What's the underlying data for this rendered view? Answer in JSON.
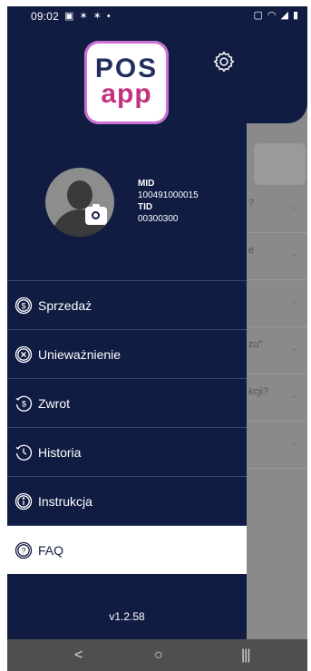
{
  "status_bar": {
    "time": "09:02",
    "left_icons": [
      "image-icon",
      "person-walk-icon",
      "person-walk-icon",
      "dot-icon"
    ],
    "right_icons": [
      "vibrate-icon",
      "wifi-icon",
      "signal-icon",
      "battery-icon"
    ]
  },
  "logo": {
    "line1": "POS",
    "line2": "app",
    "border_color": "#c96fd6",
    "line2_color": "#c0327d"
  },
  "profile": {
    "mid_label": "MID",
    "mid_value": "100491000015",
    "tid_label": "TID",
    "tid_value": "00300300"
  },
  "menu": [
    {
      "label": "Sprzedaż",
      "icon": "dollar-circle-icon",
      "active": false
    },
    {
      "label": "Unieważnienie",
      "icon": "x-circle-icon",
      "active": false
    },
    {
      "label": "Zwrot",
      "icon": "refund-icon",
      "active": false
    },
    {
      "label": "Historia",
      "icon": "history-icon",
      "active": false
    },
    {
      "label": "Instrukcja",
      "icon": "info-circle-icon",
      "active": false
    },
    {
      "label": "FAQ",
      "icon": "question-circle-icon",
      "active": true
    }
  ],
  "version": "v1.2.58",
  "background_fragments": [
    "?",
    "e",
    "zu\"",
    "kcji?"
  ],
  "colors": {
    "drawer": "#111c43",
    "active_item": "#ffffff",
    "navbar": "#4f4f4f"
  },
  "navbar": {
    "back": "<",
    "home": "○",
    "recents": "|||"
  }
}
